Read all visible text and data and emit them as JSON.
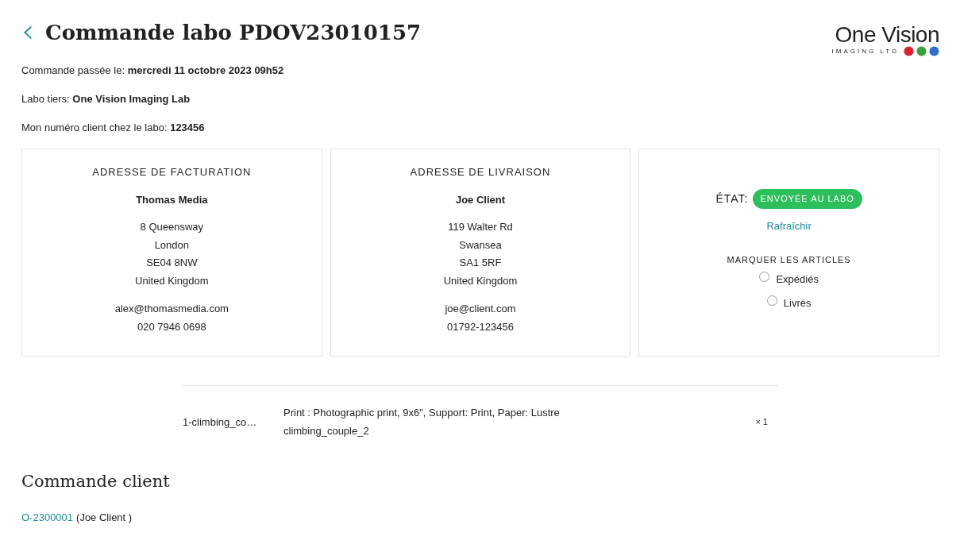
{
  "header": {
    "back": "‹",
    "title": "Commande labo PDOV23010157",
    "logo": {
      "name": "One Vision",
      "tagline": "IMAGING LTD"
    }
  },
  "info": [
    "Commande passée le: **mercredi 11 octobre 2023 09h52**",
    "Labo tiers: **One Vision Imaging Lab**",
    "Mon numéro client chez le labo: **123456**"
  ],
  "addresses": [
    {
      "title": "ADRESSE DE FACTURATION",
      "name": "Thomas Media",
      "lines": [
        "8 Queensway",
        "London",
        "SE04 8NW",
        "United Kingdom"
      ],
      "contact": [
        "alex@thomasmedia.com",
        "020 7946 0698"
      ]
    },
    {
      "title": "ADRESSE DE LIVRAISON",
      "name": "Joe Client",
      "lines": [
        "119 Walter Rd",
        "Swansea",
        "SA1 5RF",
        "United Kingdom"
      ],
      "contact": [
        "joe@client.com",
        "01792-123456"
      ]
    }
  ],
  "status": {
    "label": "ÉTAT:",
    "badge": "ENVOYÉE AU LABO",
    "refresh": "Rafraîchir",
    "mark_title": "MARQUER LES ARTICLES",
    "options": [
      {
        "label": "Expédiés",
        "checked": false
      },
      {
        "label": "Livrés",
        "checked": false
      }
    ]
  },
  "items": [
    {
      "file": "1-climbing_co…",
      "description": [
        "Print : Photographic print, 9x6\", Support: Print, Paper: Lustre",
        "climbing_couple_2"
      ],
      "quantity": "× 1"
    }
  ],
  "client_order": {
    "heading": "Commande client",
    "link": "O-2300001",
    "customer": "(Joe Client )"
  }
}
